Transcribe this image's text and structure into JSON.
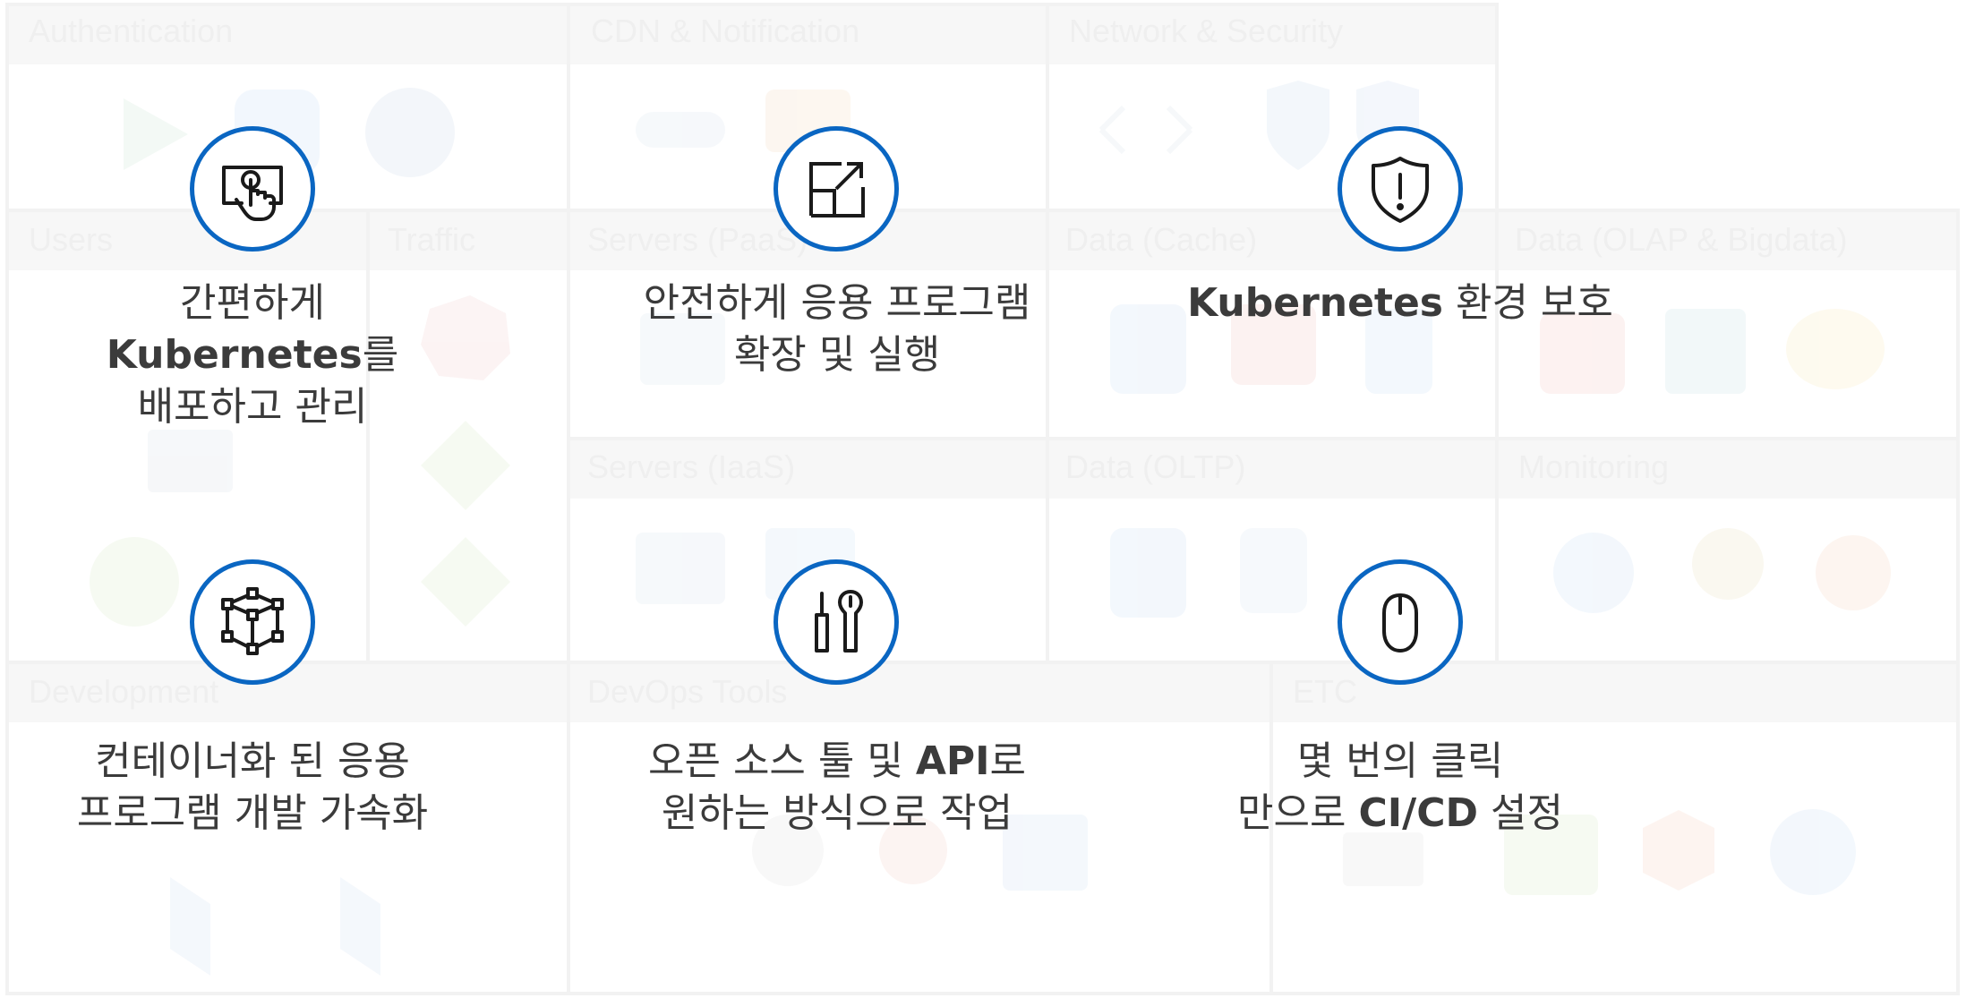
{
  "background": {
    "categories": [
      "Authentication",
      "CDN & Notification",
      "Network & Security",
      "Users",
      "Traffic",
      "Servers (PaaS)",
      "Data (Cache)",
      "Data (OLAP & Bigdata)",
      "Servers (IaaS)",
      "Data (OLTP)",
      "Monitoring",
      "Development",
      "DevOps Tools",
      "ETC"
    ]
  },
  "features": [
    {
      "icon": "touch-screen-icon",
      "lines": [
        {
          "pre": "간편하게",
          "bold": ""
        },
        {
          "pre": "",
          "bold": "Kubernetes",
          "post": "를"
        },
        {
          "pre": "배포하고 관리",
          "bold": ""
        }
      ]
    },
    {
      "icon": "expand-icon",
      "lines": [
        {
          "pre": "안전하게 응용 프로그램",
          "bold": ""
        },
        {
          "pre": "확장 및 실행",
          "bold": ""
        }
      ]
    },
    {
      "icon": "shield-alert-icon",
      "lines": [
        {
          "pre": "",
          "bold": "Kubernetes",
          "post": " 환경 보호"
        }
      ]
    },
    {
      "icon": "cube-nodes-icon",
      "lines": [
        {
          "pre": "컨테이너화 된 응용",
          "bold": ""
        },
        {
          "pre": "프로그램 개발 가속화",
          "bold": ""
        }
      ]
    },
    {
      "icon": "tools-icon",
      "lines": [
        {
          "pre": "오픈 소스 툴 및 ",
          "bold": "API",
          "post": "로"
        },
        {
          "pre": "원하는 방식으로 작업",
          "bold": ""
        }
      ]
    },
    {
      "icon": "mouse-icon",
      "lines": [
        {
          "pre": "몇 번의 클릭",
          "bold": ""
        },
        {
          "pre": "만으로 ",
          "bold": "CI/CD",
          "post": " 설정"
        }
      ]
    }
  ],
  "colors": {
    "accent": "#0a66c2",
    "text": "#3b3b3b",
    "faded": "#efefef"
  }
}
